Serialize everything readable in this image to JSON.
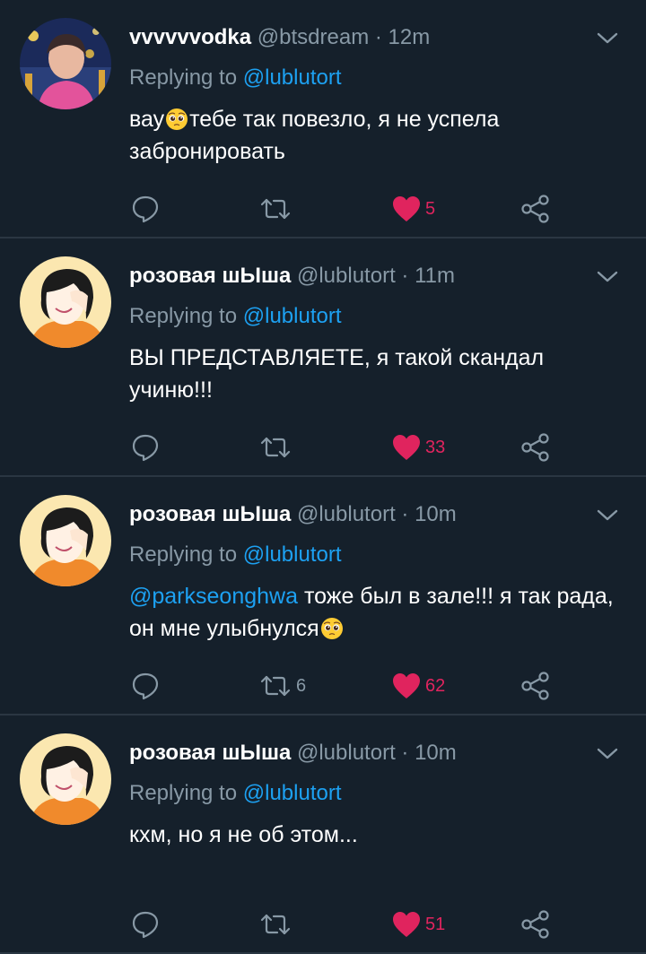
{
  "colors": {
    "background": "#15202b",
    "divider": "#2a3642",
    "secondary_text": "#8899a6",
    "link": "#1da1f2",
    "like": "#e0245e"
  },
  "tweets": [
    {
      "avatar": "avatar-photo-night-city",
      "name": "vvvvvvodka",
      "handle": "@btsdream",
      "time": "12m",
      "replying_prefix": "Replying to",
      "replying_handle": "@lublutort",
      "mention": "",
      "text_before": "вау",
      "text_after": "тебе так повезло, я не успела забронировать",
      "emoji": "pleading-face-emoji",
      "retweets": "",
      "likes": "5",
      "liked": true
    },
    {
      "avatar": "avatar-illustrated-girl",
      "name": "розовая шЫша",
      "handle": "@lublutort",
      "time": "11m",
      "replying_prefix": "Replying to",
      "replying_handle": "@lublutort",
      "mention": "",
      "text_before": "ВЫ ПРЕДСТАВЛЯЕТЕ, я такой скандал учиню!!!",
      "text_after": "",
      "emoji": "",
      "retweets": "",
      "likes": "33",
      "liked": true
    },
    {
      "avatar": "avatar-illustrated-girl",
      "name": "розовая шЫша",
      "handle": "@lublutort",
      "time": "10m",
      "replying_prefix": "Replying to",
      "replying_handle": "@lublutort",
      "mention": "@parkseonghwa",
      "text_before": " тоже был в зале!!! я так рада, он мне улыбнулся",
      "text_after": "",
      "emoji": "pleading-face-emoji",
      "retweets": "6",
      "likes": "62",
      "liked": true
    },
    {
      "avatar": "avatar-illustrated-girl",
      "name": "розовая шЫша",
      "handle": "@lublutort",
      "time": "10m",
      "replying_prefix": "Replying to",
      "replying_handle": "@lublutort",
      "mention": "",
      "text_before": "кхм, но я не об этом...",
      "text_after": "",
      "emoji": "",
      "retweets": "",
      "likes": "51",
      "liked": true
    }
  ]
}
